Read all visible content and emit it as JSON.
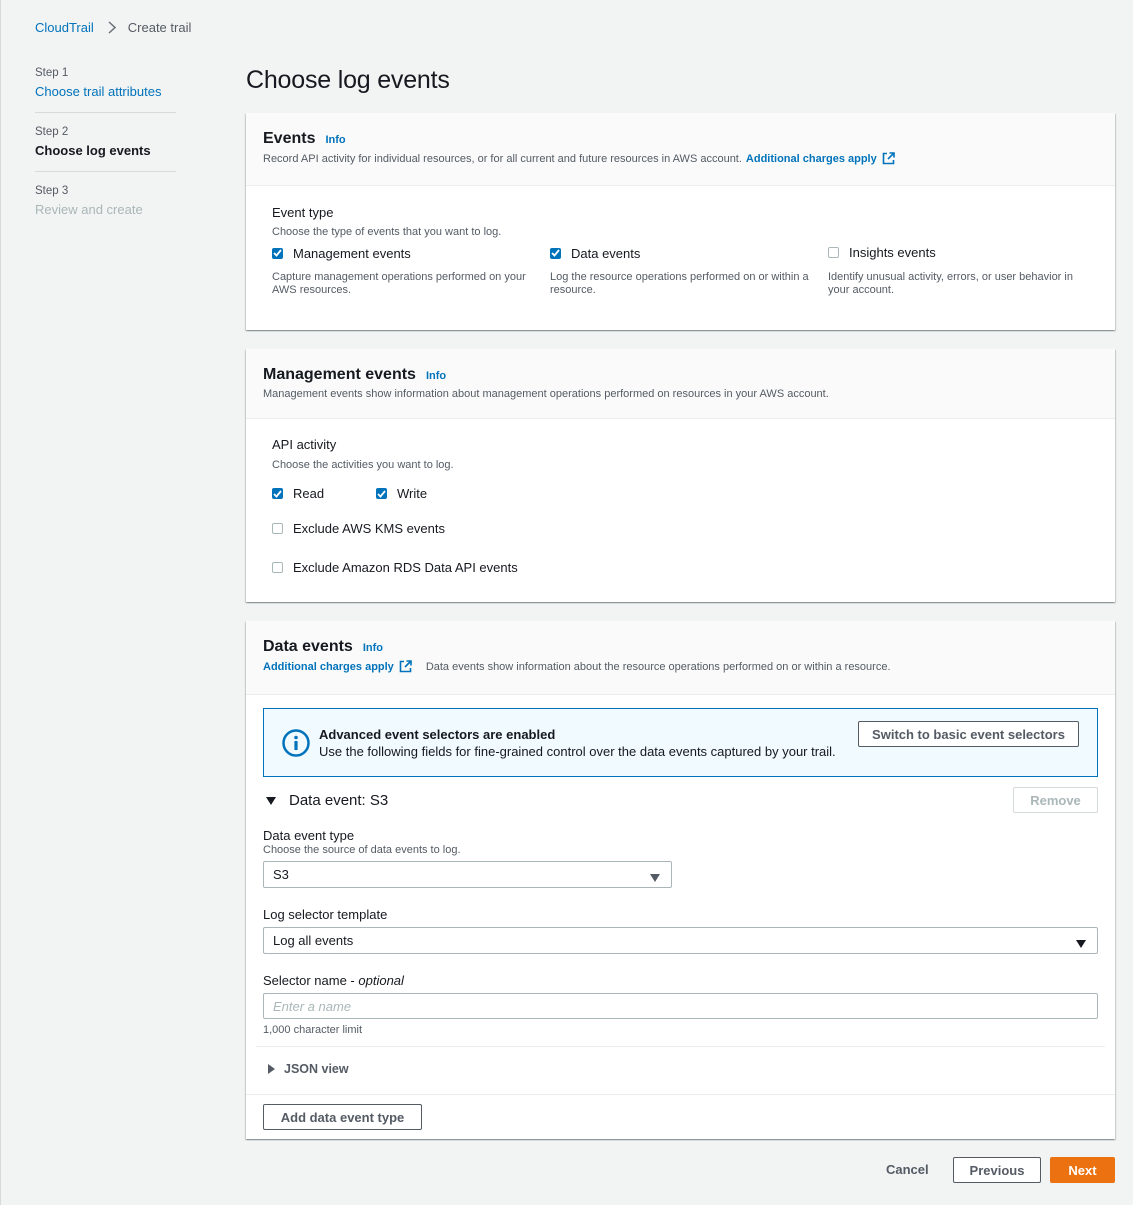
{
  "breadcrumb": {
    "root": "CloudTrail",
    "current": "Create trail"
  },
  "steps": [
    {
      "num": "Step 1",
      "label": "Choose trail attributes"
    },
    {
      "num": "Step 2",
      "label": "Choose log events"
    },
    {
      "num": "Step 3",
      "label": "Review and create"
    }
  ],
  "page_title": "Choose log events",
  "events_panel": {
    "title": "Events",
    "info": "Info",
    "desc": "Record API activity for individual resources, or for all current and future resources in AWS account.",
    "charges_link": "Additional charges apply",
    "event_type_label": "Event type",
    "event_type_desc": "Choose the type of events that you want to log.",
    "options": [
      {
        "label": "Management events",
        "checked": true,
        "desc": "Capture management operations performed on your AWS resources."
      },
      {
        "label": "Data events",
        "checked": true,
        "desc": "Log the resource operations performed on or within a resource."
      },
      {
        "label": "Insights events",
        "checked": false,
        "desc": "Identify unusual activity, errors, or user behavior in your account."
      }
    ]
  },
  "management_panel": {
    "title": "Management events",
    "info": "Info",
    "desc": "Management events show information about management operations performed on resources in your AWS account.",
    "api_label": "API activity",
    "api_desc": "Choose the activities you want to log.",
    "read_label": "Read",
    "read_checked": true,
    "write_label": "Write",
    "write_checked": true,
    "exclude_kms": "Exclude AWS KMS events",
    "exclude_kms_checked": false,
    "exclude_rds": "Exclude Amazon RDS Data API events",
    "exclude_rds_checked": false
  },
  "data_panel": {
    "title": "Data events",
    "info": "Info",
    "charges_link": "Additional charges apply",
    "desc": "Data events show information about the resource operations performed on or within a resource.",
    "alert_title": "Advanced event selectors are enabled",
    "alert_body": "Use the following fields for fine-grained control over the data events captured by your trail.",
    "switch_button": "Switch to basic event selectors",
    "section_title": "Data event: S3",
    "remove_button": "Remove",
    "type_label": "Data event type",
    "type_desc": "Choose the source of data events to log.",
    "type_value": "S3",
    "template_label": "Log selector template",
    "template_value": "Log all events",
    "name_label": "Selector name - ",
    "name_optional": "optional",
    "name_placeholder": "Enter a name",
    "name_hint": "1,000 character limit",
    "json_view": "JSON view",
    "add_button": "Add data event type"
  },
  "footer": {
    "cancel": "Cancel",
    "previous": "Previous",
    "next": "Next"
  },
  "colors": {
    "accent": "#0073bb",
    "primary": "#ec7211",
    "background": "#f2f3f3"
  }
}
